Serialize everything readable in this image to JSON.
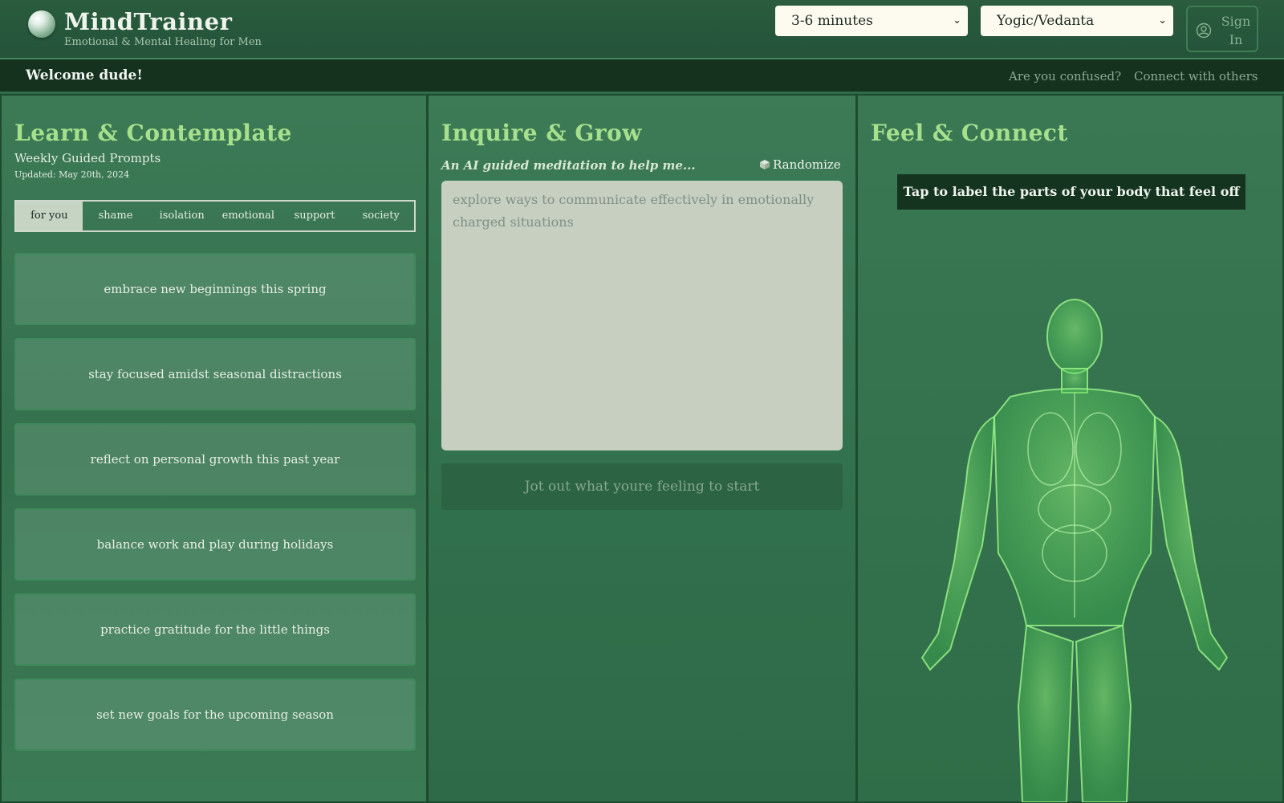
{
  "brand": {
    "title": "MindTrainer",
    "subtitle": "Emotional & Mental Healing for Men"
  },
  "controls": {
    "duration": "3-6 minutes",
    "tradition": "Yogic/Vedanta",
    "signin_label": "Sign In"
  },
  "welcome": {
    "text": "Welcome dude!",
    "links": [
      "Are you confused?",
      "Connect with others"
    ]
  },
  "learn": {
    "title": "Learn & Contemplate",
    "subtitle": "Weekly Guided Prompts",
    "updated": "Updated: May 20th, 2024",
    "tabs": [
      "for you",
      "shame",
      "isolation",
      "emotional",
      "support",
      "society"
    ],
    "active_tab": "for you",
    "prompts": [
      "embrace new beginnings this spring",
      "stay focused amidst seasonal distractions",
      "reflect on personal growth this past year",
      "balance work and play during holidays",
      "practice gratitude for the little things",
      "set new goals for the upcoming season"
    ]
  },
  "inquire": {
    "title": "Inquire & Grow",
    "caption": "An AI guided meditation to help me...",
    "randomize_label": "Randomize",
    "placeholder": "explore ways to communicate effectively in emotionally charged situations",
    "start_label": "Jot out what youre feeling to start"
  },
  "feel": {
    "title": "Feel & Connect",
    "instruction": "Tap to label the parts of your body that feel off"
  },
  "colors": {
    "accent": "#a6e08d",
    "dark_bar": "#15321f",
    "panel": "#3c7a56"
  }
}
